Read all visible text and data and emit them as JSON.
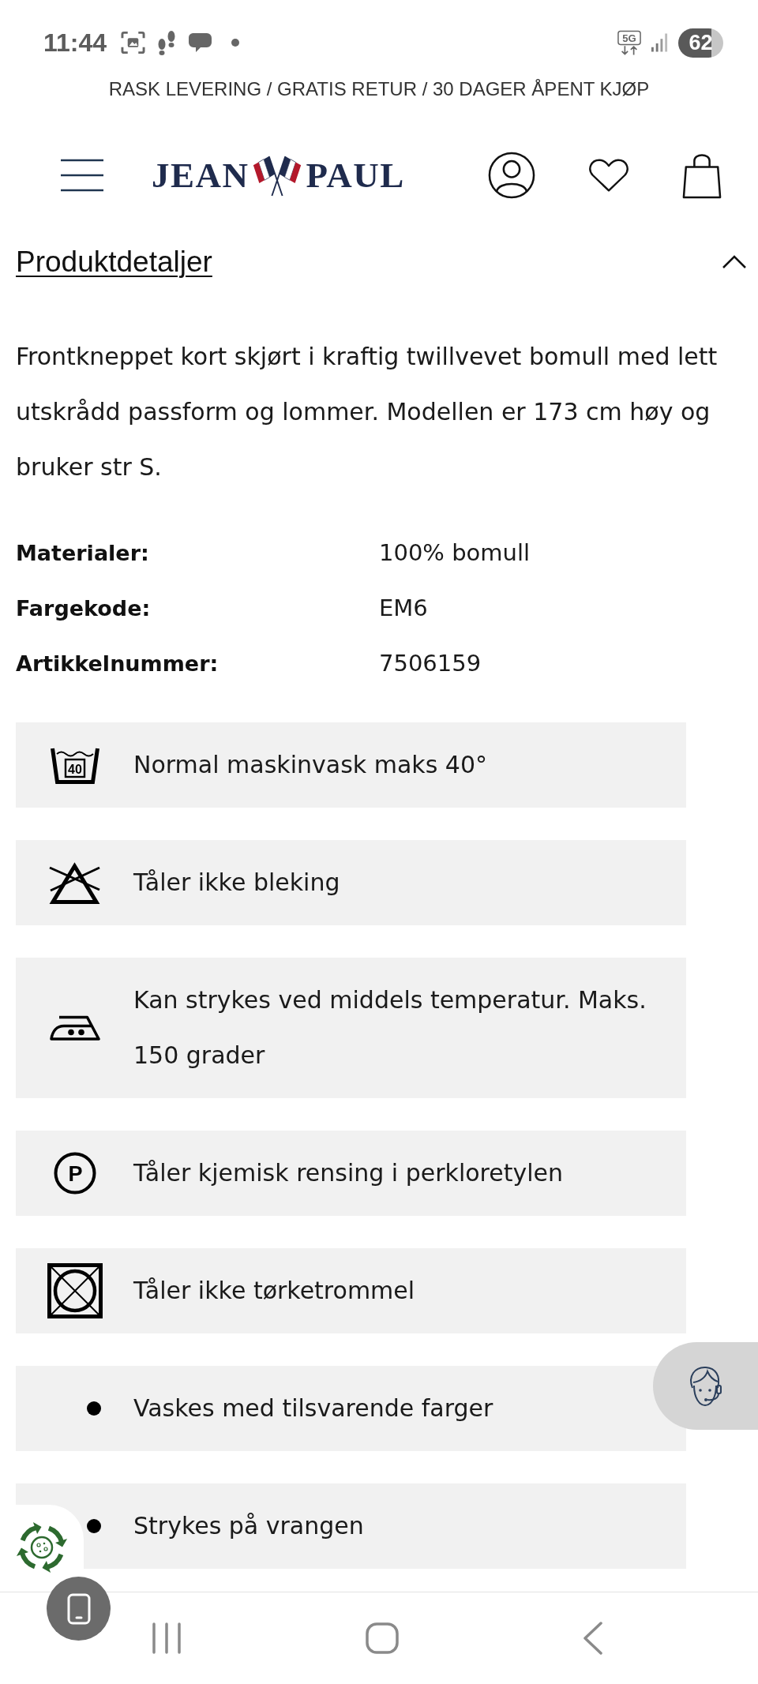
{
  "status_bar": {
    "time": "11:44",
    "network": "5G",
    "battery": "62"
  },
  "promo_banner": {
    "text": "RASK LEVERING / GRATIS RETUR / 30 DAGER ÅPENT KJØP"
  },
  "header": {
    "logo": [
      "JEAN",
      "PAUL"
    ]
  },
  "product_details": {
    "title": "Produktdetaljer",
    "expanded": true,
    "description": "Frontkneppet kort skjørt i kraftig twillvevet bomull med lett utskrådd passform og lommer. Modellen er 173 cm høy og bruker str S.",
    "specs": [
      {
        "label": "Materialer:",
        "value": "100% bomull"
      },
      {
        "label": "Fargekode:",
        "value": "EM6"
      },
      {
        "label": "Artikkelnummer:",
        "value": "7506159"
      }
    ],
    "care": [
      {
        "kind": "wash",
        "symbol_text": "40",
        "text": "Normal maskinvask maks 40°"
      },
      {
        "kind": "no-bleach",
        "text": "Tåler ikke bleking"
      },
      {
        "kind": "iron",
        "text": "Kan strykes ved middels temperatur. Maks. 150 grader"
      },
      {
        "kind": "dry-clean",
        "symbol_text": "P",
        "text": "Tåler kjemisk rensing i perkloretylen"
      },
      {
        "kind": "no-tumble-dry",
        "text": "Tåler ikke tørketrommel"
      },
      {
        "kind": "bullet",
        "text": "Vaskes med tilsvarende farger"
      },
      {
        "kind": "bullet",
        "text": "Strykes på vrangen"
      }
    ]
  }
}
